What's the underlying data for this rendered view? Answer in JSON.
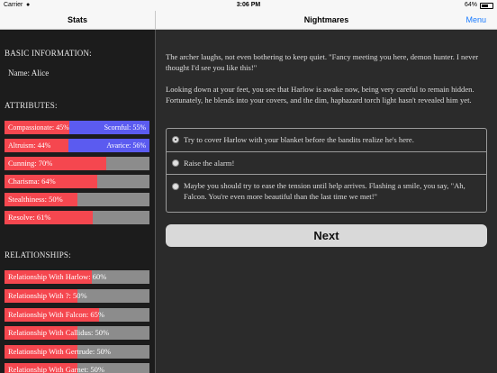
{
  "status_bar": {
    "carrier": "Carrier",
    "time": "3:06 PM",
    "battery": "64%"
  },
  "nav": {
    "left_title": "Stats",
    "center_title": "Nightmares",
    "menu_label": "Menu"
  },
  "sidebar": {
    "basic_heading": "BASIC INFORMATION:",
    "name_line": "Name: Alice",
    "attributes_heading": "ATTRIBUTES:",
    "opposed": [
      {
        "left": "Compassionate: 45%",
        "right": "Scornful: 55%",
        "value": 45
      },
      {
        "left": "Altruism: 44%",
        "right": "Avarice: 56%",
        "value": 44
      }
    ],
    "attributes": [
      {
        "label": "Cunning: 70%",
        "value": 70
      },
      {
        "label": "Charisma: 64%",
        "value": 64
      },
      {
        "label": "Stealthiness: 50%",
        "value": 50
      },
      {
        "label": "Resolve: 61%",
        "value": 61
      }
    ],
    "relationships_heading": "RELATIONSHIPS:",
    "relationships": [
      {
        "label": "Relationship With Harlow: 60%",
        "value": 60
      },
      {
        "label": "Relationship With ?: 50%",
        "value": 50
      },
      {
        "label": "Relationship With Falcon: 65%",
        "value": 65
      },
      {
        "label": "Relationship With Callidus: 50%",
        "value": 50
      },
      {
        "label": "Relationship With Gertrude: 50%",
        "value": 50
      },
      {
        "label": "Relationship With Garnet: 50%",
        "value": 50
      }
    ]
  },
  "story": {
    "paragraphs": [
      "The archer laughs, not even bothering to keep quiet. \"Fancy meeting you here, demon hunter. I never thought I'd see you like this!\"",
      "Looking down at your feet, you see that Harlow is awake now, being very careful to remain hidden. Fortunately, he blends into your covers, and the dim, haphazard torch light hasn't revealed him yet."
    ],
    "choices": [
      {
        "text": "Try to cover Harlow with your blanket before the bandits realize he's here.",
        "selected": true
      },
      {
        "text": "Raise the alarm!",
        "selected": false
      },
      {
        "text": "Maybe you should try to ease the tension until help arrives. Flashing a smile, you say, \"Ah, Falcon. You're even more beautiful than the last time we met!\"",
        "selected": false
      }
    ],
    "next_label": "Next"
  }
}
